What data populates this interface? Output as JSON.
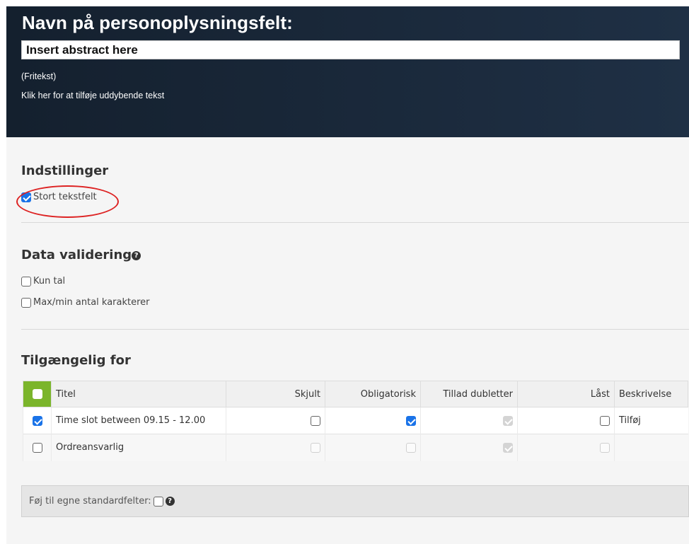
{
  "header": {
    "title": "Navn på personoplysningsfelt:",
    "input_value": "Insert abstract here",
    "hint": "(Fritekst)",
    "link": "Klik her for at tilføje uddybende tekst"
  },
  "settings": {
    "title": "Indstillinger",
    "large_text_label": "Stort tekstfelt",
    "large_text_checked": true
  },
  "validation": {
    "title": "Data validering",
    "help_icon": "question-circle-icon",
    "options": [
      {
        "label": "Kun tal",
        "checked": false
      },
      {
        "label": "Max/min antal karakterer",
        "checked": false
      }
    ]
  },
  "availability": {
    "title": "Tilgængelig for",
    "columns": {
      "title": "Titel",
      "hidden": "Skjult",
      "required": "Obligatorisk",
      "allow_duplicates": "Tillad dubletter",
      "locked": "Låst",
      "description": "Beskrivelse"
    },
    "rows": [
      {
        "title": "Time slot between 09.15 - 12.00",
        "selected": true,
        "hidden": "unchecked",
        "required": "checked",
        "allow_duplicates": "disabled-checked",
        "locked": "unchecked",
        "description": "Tilføj"
      },
      {
        "title": "Ordreansvarlig",
        "selected": false,
        "hidden": "disabled",
        "required": "disabled",
        "allow_duplicates": "disabled-checked",
        "locked": "disabled",
        "description": ""
      }
    ]
  },
  "standard_fields": {
    "label": "Føj til egne standardfelter:",
    "checked": false
  },
  "colors": {
    "header_bg": "#14202e",
    "accent_green": "#7bb52b",
    "checkbox_blue": "#1a73e8",
    "annotation_red": "#d22"
  }
}
